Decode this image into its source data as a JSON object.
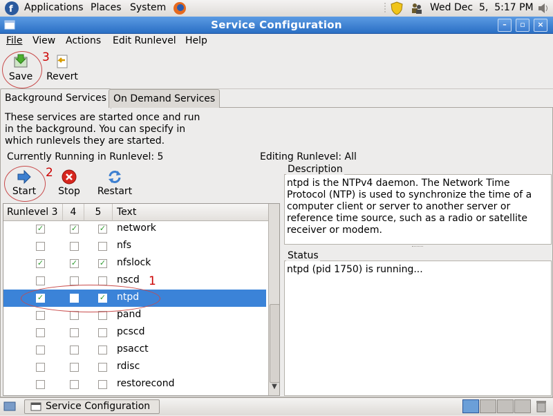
{
  "top_panel": {
    "menus": [
      "Applications",
      "Places",
      "System"
    ],
    "clock": "Wed Dec  5,  5:17 PM"
  },
  "window": {
    "title": "Service Configuration"
  },
  "menubar": {
    "file": "File",
    "view": "View",
    "actions": "Actions",
    "edit_runlevel": "Edit Runlevel",
    "help": "Help"
  },
  "toolbar": {
    "save_label": "Save",
    "revert_label": "Revert"
  },
  "tabs": {
    "background": "Background Services",
    "on_demand": "On Demand Services"
  },
  "intro_lines": [
    "These services are started once and run",
    "in the background. You can specify in",
    "which runlevels they are started."
  ],
  "runlevel": {
    "current": "Currently Running in Runlevel: 5",
    "editing": "Editing Runlevel: All"
  },
  "service_buttons": {
    "start": "Start",
    "stop": "Stop",
    "restart": "Restart"
  },
  "table": {
    "headers": [
      "Runlevel 3",
      "4",
      "5",
      "Text"
    ],
    "rows": [
      {
        "name": "network",
        "r3": true,
        "r4": true,
        "r5": true
      },
      {
        "name": "nfs",
        "r3": false,
        "r4": false,
        "r5": false
      },
      {
        "name": "nfslock",
        "r3": true,
        "r4": true,
        "r5": true
      },
      {
        "name": "nscd",
        "r3": false,
        "r4": false,
        "r5": false
      },
      {
        "name": "ntpd",
        "r3": true,
        "r4": false,
        "r5": true,
        "selected": true
      },
      {
        "name": "pand",
        "r3": false,
        "r4": false,
        "r5": false
      },
      {
        "name": "pcscd",
        "r3": false,
        "r4": false,
        "r5": false
      },
      {
        "name": "psacct",
        "r3": false,
        "r4": false,
        "r5": false
      },
      {
        "name": "rdisc",
        "r3": false,
        "r4": false,
        "r5": false
      },
      {
        "name": "restorecond",
        "r3": false,
        "r4": false,
        "r5": false
      }
    ]
  },
  "description": {
    "label": "Description",
    "lines": [
      "ntpd is the NTPv4 daemon. The Network Time",
      "Protocol (NTP) is used to synchronize the time of a",
      "computer client or server to another server or",
      "reference time source, such as a radio or satellite",
      "receiver or modem."
    ]
  },
  "status": {
    "label": "Status",
    "text": "ntpd (pid 1750) is running..."
  },
  "taskbar": {
    "window_button": "Service Configuration"
  },
  "annotations": {
    "one": "1",
    "two": "2",
    "three": "3"
  },
  "colors": {
    "selection": "#3b83d8",
    "titlebar": "#2a6fc4",
    "annotation": "#cc0000"
  }
}
